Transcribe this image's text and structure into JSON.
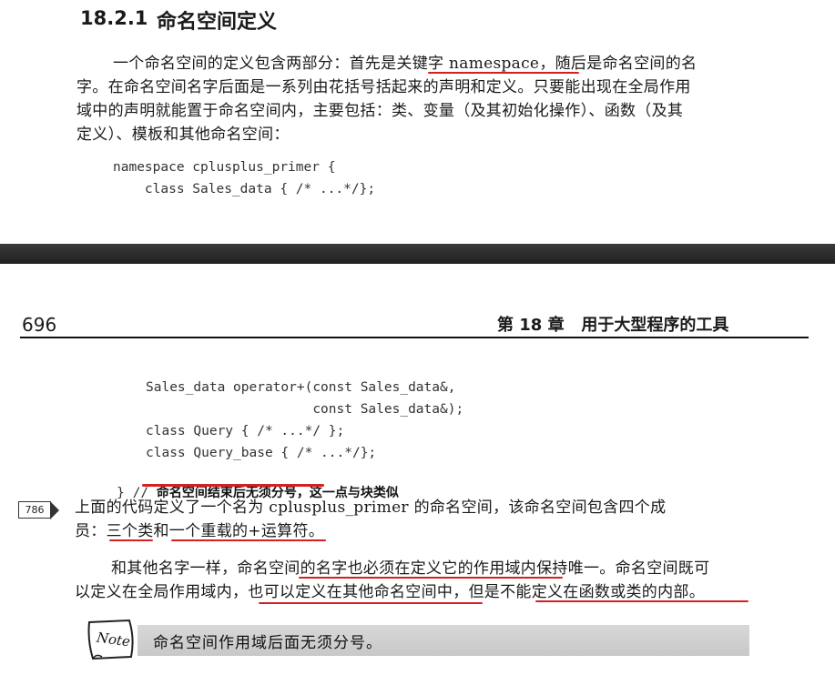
{
  "section": {
    "number": "18.2.1",
    "title": "命名空间定义"
  },
  "paragraph1": {
    "line1_a": "一个命名空间的定义包含两部分：首先是",
    "line1_b": "关键字 namespace",
    "line1_c": "，随后是命名空间的名",
    "line2": "字。在命名空间名字后面是一系列由花括号括起来的声明和定义。只要能出现在全局作用",
    "line3": "域中的声明就能置于命名空间内，主要包括：类、变量（及其初始化操作）、函数（及其",
    "line4": "定义）、模板和其他命名空间："
  },
  "code1": {
    "line1": "namespace cplusplus_primer {",
    "line2": "    class Sales_data { /* ...*/};"
  },
  "page_header": {
    "page_number": "696",
    "chapter": "第 18 章   用于大型程序的工具"
  },
  "code2": {
    "line1": "Sales_data operator+(const Sales_data&,",
    "line2": "                     const Sales_data&);",
    "line3": "class Query { /* ...*/ };",
    "line4": "class Query_base { /* ...*/};",
    "line5_code": "} // ",
    "line5_comment": "命名空间结束后无须分号，这一点与块类似"
  },
  "margin_ref": "786",
  "paragraph2": {
    "line1": "上面的代码定义了一个名为 cplusplus_primer 的命名空间，该命名空间包含四个成",
    "line2": "员：三个类和一个重载的+运算符。"
  },
  "paragraph3": {
    "line1": "和其他名字一样，命名空间的名字也必须在定义它的作用域内保持唯一。命名空间既可",
    "line2": "以定义在全局作用域内，也可以定义在其他命名空间中，但是不能定义在函数或类的内部。"
  },
  "note": {
    "icon_label": "Note",
    "text": "命名空间作用域后面无须分号。"
  },
  "colors": {
    "annotation_red": "#d42020",
    "divider": "#2a2a2a",
    "note_bar": "#cfcfcf"
  }
}
